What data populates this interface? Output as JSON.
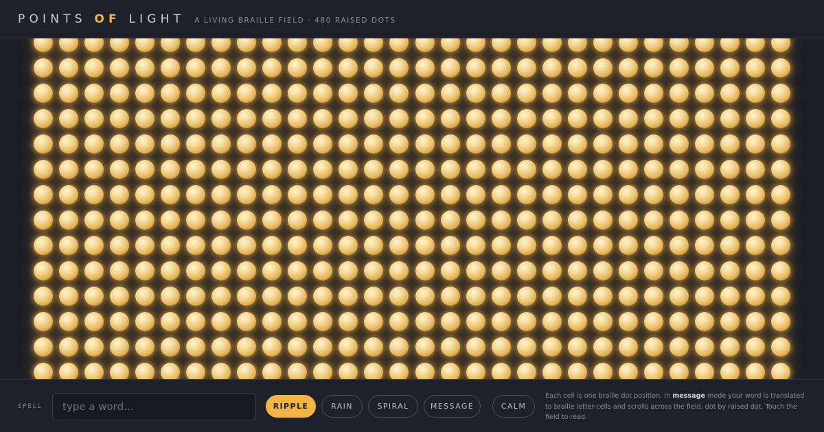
{
  "header": {
    "title_before": "POINTS ",
    "title_accent": "OF",
    "title_after": " LIGHT",
    "tagline": "A LIVING BRAILLE FIELD · 480 RAISED DOTS"
  },
  "field": {
    "columns": 30,
    "visible_rows": 14,
    "dot_state": "raised"
  },
  "controls": {
    "spell_label": "SPELL",
    "input_placeholder": "type a word...",
    "input_value": "",
    "modes": [
      {
        "label": "RIPPLE",
        "active": true
      },
      {
        "label": "RAIN",
        "active": false
      },
      {
        "label": "SPIRAL",
        "active": false
      },
      {
        "label": "MESSAGE",
        "active": false
      }
    ],
    "calm_label": "CALM",
    "info_before": "Each cell is one braille dot position. In ",
    "info_bold": "message",
    "info_after": " mode your word is translated to braille letter-cells and scrolls across the field, dot by raised dot. Touch the field to read."
  },
  "colors": {
    "accent": "#f2b544",
    "background": "#1c1f27",
    "dot": "#e7bc62"
  }
}
